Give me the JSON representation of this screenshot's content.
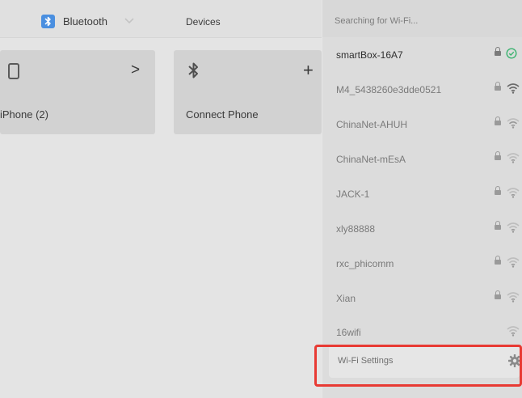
{
  "bluetooth_panel": {
    "tab_label": "Bluetooth",
    "devices_label": "Devices",
    "cards": [
      {
        "label": "iPhone (2)",
        "icon": "phone-icon",
        "action": ">"
      },
      {
        "label": "Connect Phone",
        "icon": "bluetooth-icon",
        "action": "+"
      }
    ]
  },
  "wifi_dropdown": {
    "header": "Searching for Wi-Fi...",
    "networks": [
      {
        "name": "smartBox-16A7",
        "locked": true,
        "connected": true
      },
      {
        "name": "M4_5438260e3dde0521",
        "locked": true,
        "connected": false
      },
      {
        "name": "ChinaNet-AHUH",
        "locked": true,
        "connected": false
      },
      {
        "name": "ChinaNet-mEsA",
        "locked": true,
        "connected": false
      },
      {
        "name": "JACK-1",
        "locked": true,
        "connected": false
      },
      {
        "name": "xly88888",
        "locked": true,
        "connected": false
      },
      {
        "name": "rxc_phicomm",
        "locked": true,
        "connected": false
      },
      {
        "name": "Xian",
        "locked": true,
        "connected": false
      },
      {
        "name": "16wifi",
        "locked": false,
        "connected": false
      }
    ],
    "settings_label": "Wi-Fi Settings"
  },
  "colors": {
    "accent_blue": "#4a8fe0",
    "connected_green": "#3cb371",
    "highlight_red": "#e83a33"
  }
}
